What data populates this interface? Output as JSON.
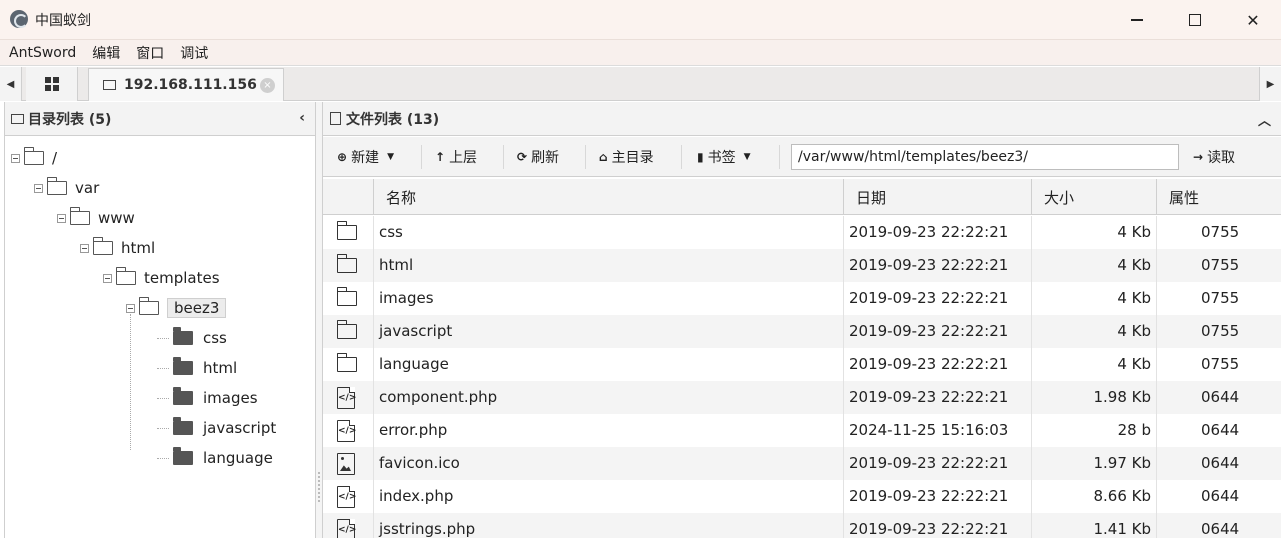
{
  "window": {
    "title": "中国蚁剑",
    "minimize": "—",
    "maximize": "☐",
    "close": "✕"
  },
  "menu": [
    "AntSword",
    "编辑",
    "窗口",
    "调试"
  ],
  "tabs": {
    "left_arrow": "◀",
    "right_arrow": "▶",
    "host_tab": "192.168.111.156",
    "host_tab_close": "×"
  },
  "dir_panel": {
    "title": "目录列表 (5)",
    "collapse": "‹",
    "tree": [
      {
        "label": "/",
        "level": 0,
        "type": "open"
      },
      {
        "label": "var",
        "level": 1,
        "type": "open"
      },
      {
        "label": "www",
        "level": 2,
        "type": "open"
      },
      {
        "label": "html",
        "level": 3,
        "type": "open"
      },
      {
        "label": "templates",
        "level": 4,
        "type": "open"
      },
      {
        "label": "beez3",
        "level": 5,
        "type": "open",
        "selected": true
      },
      {
        "label": "css",
        "level": 6,
        "type": "closed"
      },
      {
        "label": "html",
        "level": 6,
        "type": "closed"
      },
      {
        "label": "images",
        "level": 6,
        "type": "closed"
      },
      {
        "label": "javascript",
        "level": 6,
        "type": "closed"
      },
      {
        "label": "language",
        "level": 6,
        "type": "closed"
      }
    ]
  },
  "file_panel": {
    "title": "文件列表 (13)",
    "collapse": "︿",
    "toolbar": {
      "new_label": "新建",
      "up_label": "上层",
      "refresh_label": "刷新",
      "home_label": "主目录",
      "bookmark_label": "书签",
      "path_value": "/var/www/html/templates/beez3/",
      "read_label": "读取"
    },
    "columns": {
      "name": "名称",
      "date": "日期",
      "size": "大小",
      "perm": "属性"
    },
    "rows": [
      {
        "icon": "folder-icon",
        "name": "css",
        "date": "2019-09-23 22:22:21",
        "size": "4 Kb",
        "perm": "0755"
      },
      {
        "icon": "folder-icon",
        "name": "html",
        "date": "2019-09-23 22:22:21",
        "size": "4 Kb",
        "perm": "0755"
      },
      {
        "icon": "folder-icon",
        "name": "images",
        "date": "2019-09-23 22:22:21",
        "size": "4 Kb",
        "perm": "0755"
      },
      {
        "icon": "folder-icon",
        "name": "javascript",
        "date": "2019-09-23 22:22:21",
        "size": "4 Kb",
        "perm": "0755"
      },
      {
        "icon": "folder-icon",
        "name": "language",
        "date": "2019-09-23 22:22:21",
        "size": "4 Kb",
        "perm": "0755"
      },
      {
        "icon": "code-file-icon",
        "name": "component.php",
        "date": "2019-09-23 22:22:21",
        "size": "1.98 Kb",
        "perm": "0644"
      },
      {
        "icon": "code-file-icon",
        "name": "error.php",
        "date": "2024-11-25 15:16:03",
        "size": "28 b",
        "perm": "0644"
      },
      {
        "icon": "image-file-icon",
        "name": "favicon.ico",
        "date": "2019-09-23 22:22:21",
        "size": "1.97 Kb",
        "perm": "0644"
      },
      {
        "icon": "code-file-icon",
        "name": "index.php",
        "date": "2019-09-23 22:22:21",
        "size": "8.66 Kb",
        "perm": "0644"
      },
      {
        "icon": "code-file-icon",
        "name": "jsstrings.php",
        "date": "2019-09-23 22:22:21",
        "size": "1.41 Kb",
        "perm": "0644"
      }
    ]
  }
}
